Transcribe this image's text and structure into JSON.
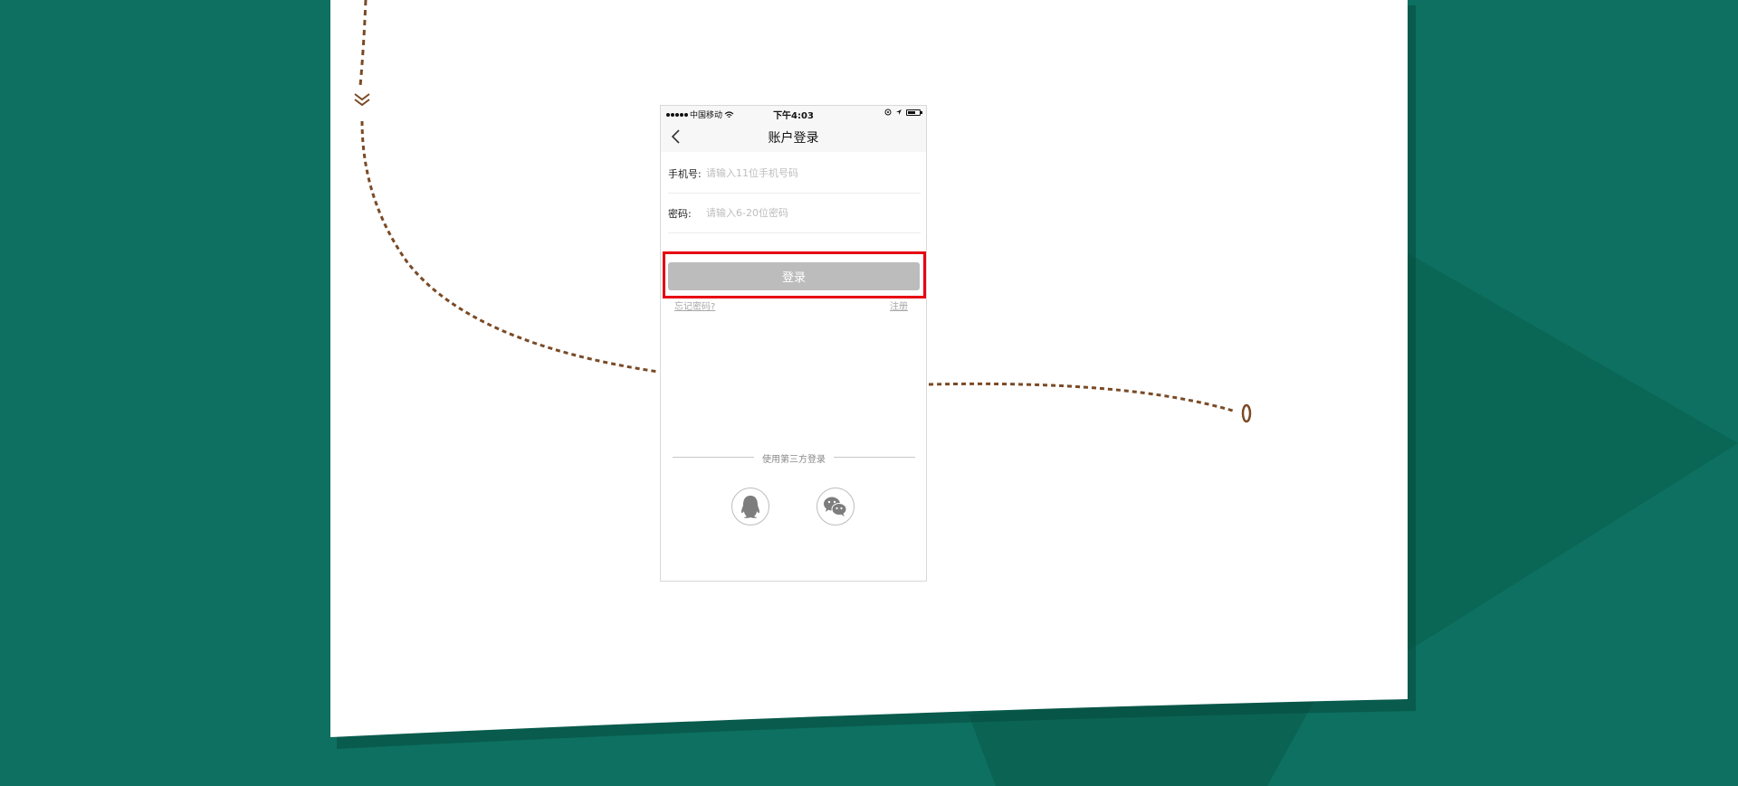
{
  "status_bar": {
    "carrier": "中国移动",
    "time": "下午4:03"
  },
  "nav": {
    "title": "账户登录"
  },
  "form": {
    "phone_label": "手机号:",
    "phone_placeholder": "请输入11位手机号码",
    "password_label": "密码:",
    "password_placeholder": "请输入6-20位密码"
  },
  "actions": {
    "login_label": "登录",
    "forgot_label": "忘记密码?",
    "register_label": "注册"
  },
  "third_party": {
    "label": "使用第三方登录"
  },
  "icons": [
    "back-icon",
    "wifi-icon",
    "location-icon",
    "battery-icon",
    "qq-icon",
    "wechat-icon"
  ],
  "colors": {
    "background": "#0d7060",
    "path": "#7a4a25",
    "highlight": "#e60012",
    "button": "#bdbcbc"
  }
}
